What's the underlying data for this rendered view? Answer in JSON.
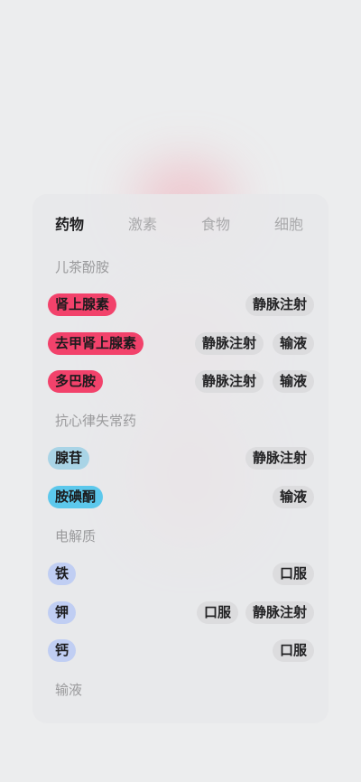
{
  "tabs": [
    "药物",
    "激素",
    "食物",
    "细胞"
  ],
  "active_tab": "药物",
  "colors": {
    "catecholamine": "#f2426b",
    "antiarrhythmic_light": "#a9d4e6",
    "antiarrhythmic_bright": "#5cc8ec",
    "electrolyte": "#c0cef3",
    "route_bg": "#dcdcde"
  },
  "sections": [
    {
      "title": "儿茶酚胺",
      "items": [
        {
          "name": "肾上腺素",
          "color": "#f2426b",
          "routes": [
            "静脉注射"
          ]
        },
        {
          "name": "去甲肾上腺素",
          "color": "#f2426b",
          "routes": [
            "静脉注射",
            "输液"
          ]
        },
        {
          "name": "多巴胺",
          "color": "#f2426b",
          "routes": [
            "静脉注射",
            "输液"
          ]
        }
      ]
    },
    {
      "title": "抗心律失常药",
      "items": [
        {
          "name": "腺苷",
          "color": "#a9d4e6",
          "routes": [
            "静脉注射"
          ]
        },
        {
          "name": "胺碘酮",
          "color": "#5cc8ec",
          "routes": [
            "输液"
          ]
        }
      ]
    },
    {
      "title": "电解质",
      "items": [
        {
          "name": "铁",
          "color": "#c0cef3",
          "routes": [
            "口服"
          ]
        },
        {
          "name": "钾",
          "color": "#c0cef3",
          "routes": [
            "口服",
            "静脉注射"
          ]
        },
        {
          "name": "钙",
          "color": "#c0cef3",
          "routes": [
            "口服"
          ]
        }
      ]
    },
    {
      "title": "输液",
      "items": []
    }
  ]
}
